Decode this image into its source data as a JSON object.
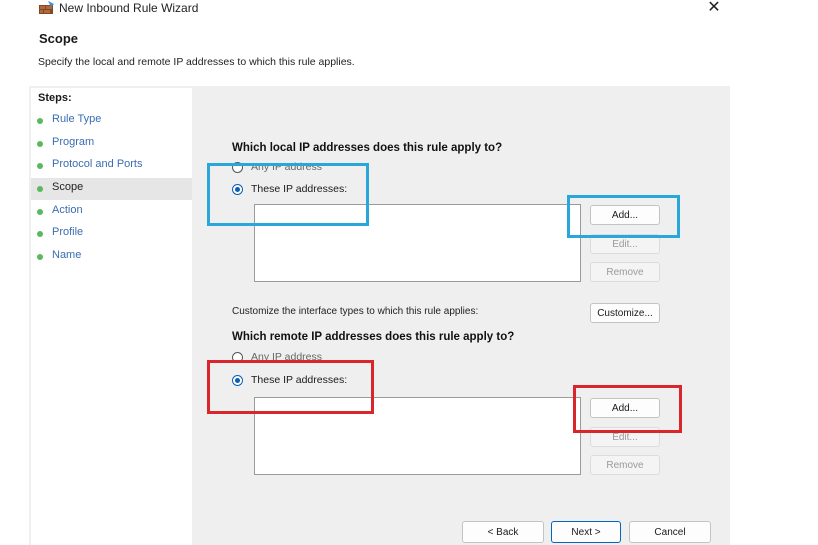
{
  "window": {
    "title": "New Inbound Rule Wizard",
    "close_symbol": "✕"
  },
  "header": {
    "title": "Scope",
    "description": "Specify the local and remote IP addresses to which this rule applies."
  },
  "steps": {
    "title": "Steps:",
    "items": [
      {
        "label": "Rule Type"
      },
      {
        "label": "Program"
      },
      {
        "label": "Protocol and Ports"
      },
      {
        "label": "Scope",
        "active": true
      },
      {
        "label": "Action"
      },
      {
        "label": "Profile"
      },
      {
        "label": "Name"
      }
    ]
  },
  "local": {
    "question": "Which local IP addresses does this rule apply to?",
    "any_label": "Any IP address",
    "these_label": "These IP addresses:",
    "selected": "these",
    "add_label": "Add...",
    "edit_label": "Edit...",
    "remove_label": "Remove"
  },
  "customize": {
    "text": "Customize the interface types to which this rule applies:",
    "button_label": "Customize..."
  },
  "remote": {
    "question": "Which remote IP addresses does this rule apply to?",
    "any_label": "Any IP address",
    "these_label": "These IP addresses:",
    "selected": "these",
    "add_label": "Add...",
    "edit_label": "Edit...",
    "remove_label": "Remove"
  },
  "footer": {
    "back_label": "< Back",
    "next_label": "Next >",
    "cancel_label": "Cancel"
  },
  "colors": {
    "highlight_blue": "#2aa6d8",
    "highlight_red": "#d8262c",
    "step_link": "#3a6db2",
    "step_dot": "#5cb85c",
    "radio_selected": "#0a5fb4"
  },
  "icons": {
    "app": "firewall-wizard-icon",
    "close": "close-icon",
    "step_bullet": "green-dot-icon"
  }
}
